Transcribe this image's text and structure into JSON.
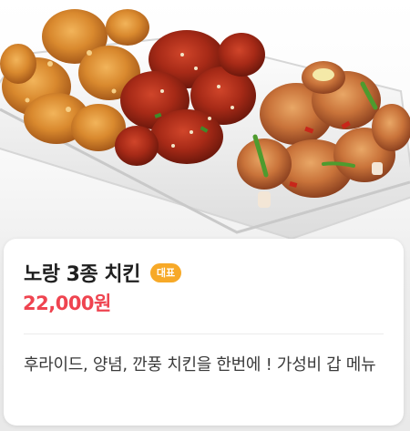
{
  "product": {
    "image_alt": "노랑 3종 치킨",
    "name": "노랑 3종 치킨",
    "badge": "대표",
    "price": "22,000원",
    "description": "후라이드, 양념, 깐풍 치킨을 한번에 ! 가성비 갑 메뉴"
  },
  "colors": {
    "price": "#ef4450",
    "badge": "#f7a928",
    "title": "#1f1f1f",
    "description": "#3a3a3a"
  }
}
